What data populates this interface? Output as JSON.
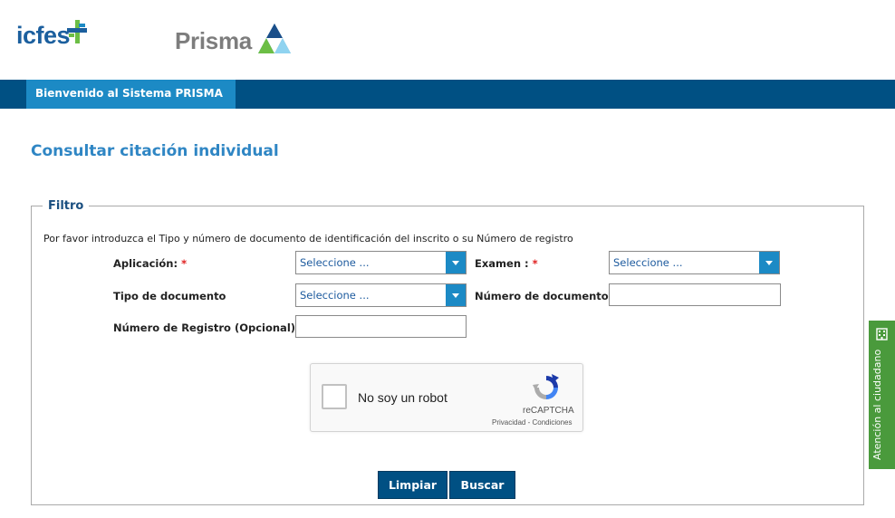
{
  "brand": {
    "icfes_logo_text": "icfes",
    "prisma_logo_text": "Prisma",
    "colors": {
      "icfes_blue": "#1b5f9e",
      "icfes_green": "#6cbe45",
      "navbar": "#005083",
      "nav_active": "#1c8ac5",
      "title": "#2f86c4",
      "side_tab": "#4a9a3c"
    }
  },
  "nav": {
    "active_item": "Bienvenido al Sistema PRISMA"
  },
  "page": {
    "title": "Consultar citación individual"
  },
  "filter": {
    "legend": "Filtro",
    "instructions": "Por favor introduzca el Tipo y número de documento de identificación del inscrito o su Número de registro",
    "aplicacion": {
      "label": "Aplicación:",
      "required": "*",
      "value": "Seleccione ..."
    },
    "examen": {
      "label": "Examen :",
      "required": "*",
      "value": "Seleccione ..."
    },
    "tipo_documento": {
      "label": "Tipo de documento",
      "value": "Seleccione ..."
    },
    "numero_documento": {
      "label": "Número de documento",
      "value": ""
    },
    "numero_registro": {
      "label": "Número de Registro (Opcional)",
      "value": ""
    }
  },
  "captcha": {
    "checkbox_label": "No soy un robot",
    "brand": "reCAPTCHA",
    "links": "Privacidad - Condiciones",
    "icon": "recaptcha-icon"
  },
  "buttons": {
    "clear": "Limpiar",
    "search": "Buscar"
  },
  "side_tab": {
    "label": "Atención al ciudadano",
    "icon": "building-icon"
  }
}
